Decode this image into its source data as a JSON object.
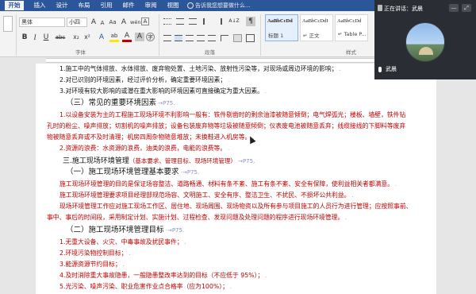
{
  "ribbon": {
    "tabs": [
      "开始",
      "插入",
      "设计",
      "布局",
      "引用",
      "邮件",
      "审阅",
      "视图"
    ],
    "active_tab": "开始",
    "tell_me": "告诉我您想要做什么...",
    "font": {
      "name": "黑体",
      "size": "小四",
      "group_label": "字体",
      "bold": "B",
      "italic": "I",
      "underline": "U",
      "strike": "abc",
      "subscript": "x₂",
      "superscript": "x²",
      "clear_format": "A",
      "grow": "A",
      "shrink": "A",
      "change_case": "Aa",
      "phonetic": "wén",
      "char_border": "A",
      "highlight": "ab",
      "font_color": "A",
      "shade": "A",
      "enclose": "字"
    },
    "paragraph": {
      "group_label": "段落",
      "marks": "¶",
      "sort": "A↓Z"
    },
    "styles": {
      "group_label": "样式",
      "items": [
        {
          "sample": "AaBbCcDd",
          "name": "标题 1"
        },
        {
          "sample": "AaBbCcDdI",
          "name": "↵ 正文"
        },
        {
          "sample": "AaBbCcDd",
          "name": "↵ Table P..."
        }
      ]
    }
  },
  "document": {
    "lines": [
      {
        "text": "1.施工中的气体排放、水体排放、废弃物处置、土地污染、放射性污染等，对现场或周边环境的影响；",
        "pm": " ."
      },
      {
        "text": "2.对已识别的环境因素，经过评价分析，确定重要环境因素；",
        "pm": " ."
      },
      {
        "text": "3.对环境有较大影响的或潜在重大影响的环境因素可直接确定为重大因素。",
        "pm": " ."
      },
      {
        "text": "（三）常见的重要环境因素",
        "ref": " →P75.",
        "style": "head"
      },
      {
        "text": "1.以设备安装为主的工程施工现场环境不利影响一般有：铁件剔凿时的剩余油漆被随意倾倒；电气焊弧光；楼板、墙壁，铁件钻",
        "style": "red"
      },
      {
        "text": "孔时的粉尘、噪声排放；切割机的噪声排放；设备包装废弃物等垃圾被随意倾倒；仪表废电池被随意丢弃；线缆接线的下脚料等废弃",
        "style": "red"
      },
      {
        "text": "物被随意丢弃或不及时清理；机房四周杂物随意堆放；未换鞋进入机房等。",
        "pm": " .",
        "style": "red"
      },
      {
        "text": "2.资源的浪费：水资源的浪费，油类的浪费，电能的浪费等。",
        "pm": " .",
        "style": "red"
      },
      {
        "text": "三.施工现场环境管理",
        "note": "（基本要求、管理目标、现场环境管理）",
        "ref": " →P75.",
        "style": "head2"
      },
      {
        "text": "（一）施工现场环境管理基本要求",
        "ref": " ·→P75.",
        "style": "head"
      },
      {
        "text": "施工现场环境管理的目的是保证场容整洁、道路畅通、材料有条不紊、施工有条不紊、安全有保障，使利益相关者都满意。",
        "pm": " .",
        "style": "red"
      },
      {
        "text": "施工现场环境管理要求项目经理部规范场容、文明施工、安全有序、整洁卫生、不扰民、不损坏公共利益。",
        "pm": " .",
        "style": "red"
      },
      {
        "text": "现场环境管理工作应对施工现场工作区、居住地、现场周围、现场物资以及所有参与项目施工的人员行为进行管理；应按照事前、",
        "style": "red"
      },
      {
        "text": "事中、事后的时间段，采用制定计划、实施计划、过程检查、发现问题及处理问题的程序进行现场环境管理。",
        "pm": " .",
        "style": "red"
      },
      {
        "text": "（二）施工现场环境管理目标",
        "ref": " ·→P75.",
        "style": "head"
      },
      {
        "text": "1.无重大设备、火灾、中毒事故及扰民事件；",
        "pm": " .",
        "style": "red"
      },
      {
        "text": "2.环境污染物控制目标；",
        "pm": " .",
        "style": "red"
      },
      {
        "text": "3.能源资源节约目标；",
        "pm": " .",
        "style": "red"
      },
      {
        "text": "4.及时消除重大事故隐患，一般隐患整改率达到的目标（不应低于  95%）；",
        "pm": " .",
        "style": "red"
      },
      {
        "text": "5.光污染、噪声污染、职业危害作业点合格率（应为100%）；",
        "pm": " .",
        "style": "red"
      }
    ]
  },
  "meeting": {
    "speaking_label": "正在讲话：",
    "speaker": "武晨",
    "participant_name": "武晨",
    "ctrl_minimize": "—",
    "ctrl_expand": "⤢",
    "mic_icon": "mic-icon"
  }
}
